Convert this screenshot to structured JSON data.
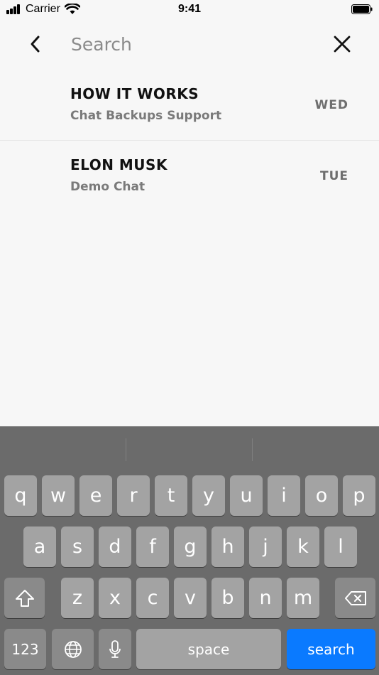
{
  "status_bar": {
    "carrier": "Carrier",
    "time": "9:41"
  },
  "search": {
    "placeholder": "Search",
    "value": ""
  },
  "icons": {
    "back": "chevron-left-icon",
    "close": "close-icon",
    "shift": "shift-icon",
    "backspace": "backspace-icon",
    "globe": "globe-icon",
    "mic": "microphone-icon"
  },
  "chats": [
    {
      "title": "HOW IT WORKS",
      "subtitle": "Chat Backups Support",
      "day": "WED"
    },
    {
      "title": "ELON MUSK",
      "subtitle": "Demo Chat",
      "day": "TUE"
    }
  ],
  "keyboard": {
    "row1": [
      "q",
      "w",
      "e",
      "r",
      "t",
      "y",
      "u",
      "i",
      "o",
      "p"
    ],
    "row2": [
      "a",
      "s",
      "d",
      "f",
      "g",
      "h",
      "j",
      "k",
      "l"
    ],
    "row3": [
      "z",
      "x",
      "c",
      "v",
      "b",
      "n",
      "m"
    ],
    "numbers_label": "123",
    "space_label": "space",
    "search_label": "search",
    "search_color": "#0a7aff"
  }
}
